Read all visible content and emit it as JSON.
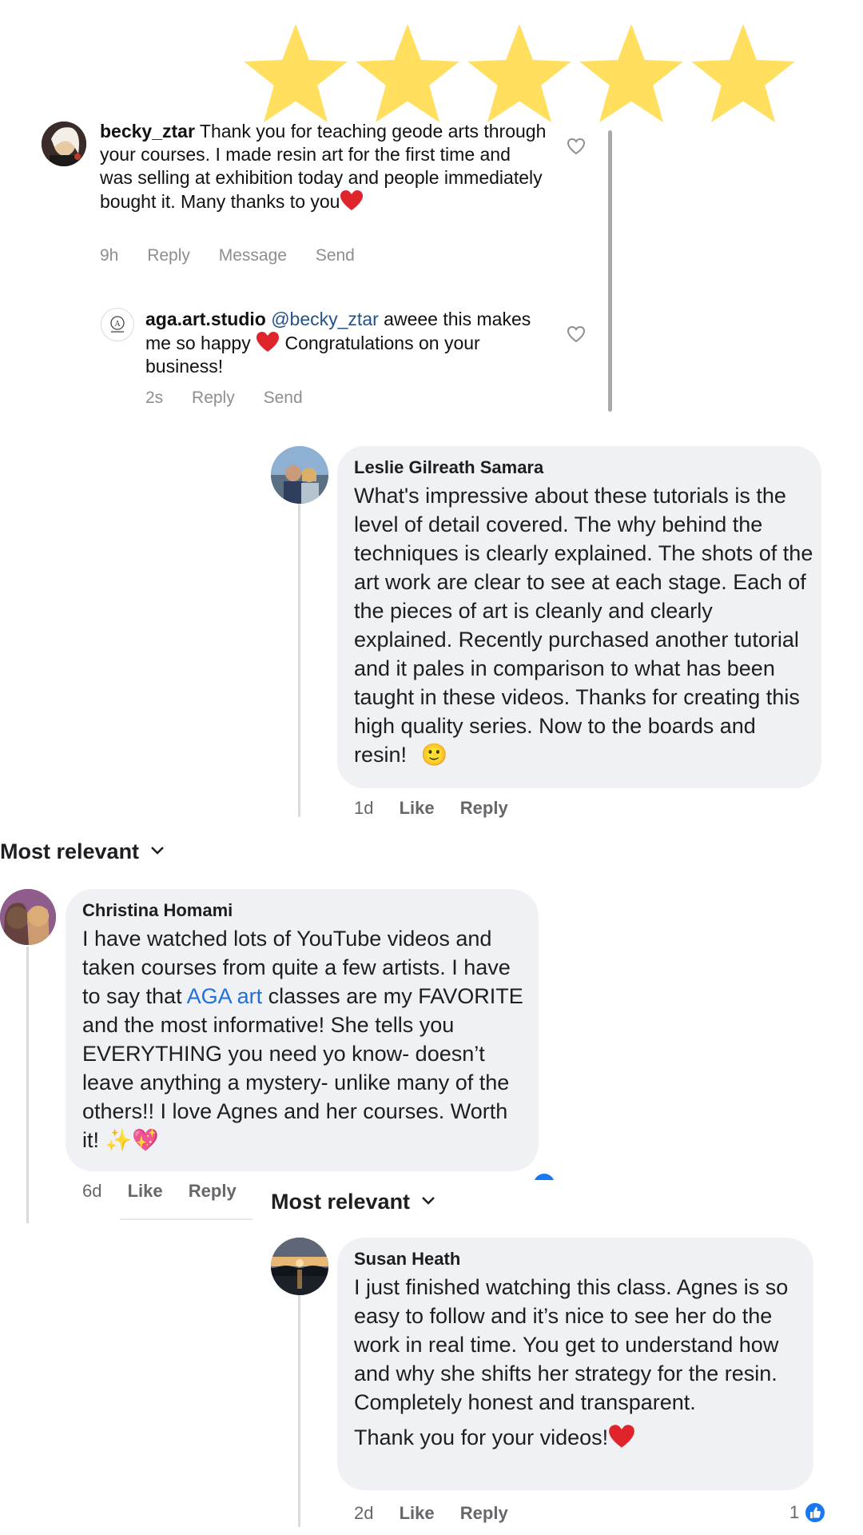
{
  "colors": {
    "star": "#ffdf5d",
    "mention": "#23528a",
    "link": "#216fdb",
    "bubble": "#f0f1f4",
    "heart": "#e0242c",
    "like_badge": "#1877f2"
  },
  "rating": {
    "stars": 5,
    "max": 5
  },
  "instagram": {
    "comment": {
      "username": "becky_ztar",
      "text": "Thank you for teaching geode arts through your courses.  I made resin art for the first time and was selling at exhibition today and people immediately bought it. Many thanks to you",
      "time": "9h",
      "actions": [
        "Reply",
        "Message",
        "Send"
      ]
    },
    "reply": {
      "username": "aga.art.studio",
      "mention": "@becky_ztar",
      "text_before": "aweee this makes me so happy",
      "text_after": "Congratulations on your business!",
      "time": "2s",
      "actions": [
        "Reply",
        "Send"
      ]
    }
  },
  "facebook": {
    "sort_label": "Most relevant",
    "comments": [
      {
        "name": "Leslie Gilreath Samara",
        "text": "What's impressive about these tutorials is the level of detail covered.  The why behind the techniques is clearly explained. The shots of the art work are clear to see at each stage. Each of the pieces of art is cleanly and clearly explained.  Recently purchased another tutorial and it pales in comparison to what has been taught in these videos.  Thanks for creating this high quality series.  Now to the boards and resin!",
        "emoji": "🙂",
        "time": "1d",
        "like": "Like",
        "reply": "Reply"
      },
      {
        "name": "Christina Homami",
        "text_before": "I have watched lots of YouTube videos and taken courses from quite a few artists. I have to say that",
        "link_text": "AGA art",
        "text_after": "classes are my FAVORITE and the most informative! She tells you EVERYTHING you need yo know- doesn’t leave anything a mystery- unlike many of the others!! I love Agnes and her courses.  Worth it!",
        "emoji": "✨💖",
        "time": "6d",
        "like": "Like",
        "reply": "Reply"
      },
      {
        "name": "Susan Heath",
        "text": "I just finished watching this class. Agnes is so easy to follow and it’s nice to see her do the work in real time. You get to understand how and why she shifts her strategy for the resin. Completely honest and transparent.",
        "text2": "Thank you for your videos!",
        "time": "2d",
        "like": "Like",
        "reply": "Reply",
        "reaction_count": "1"
      }
    ]
  }
}
